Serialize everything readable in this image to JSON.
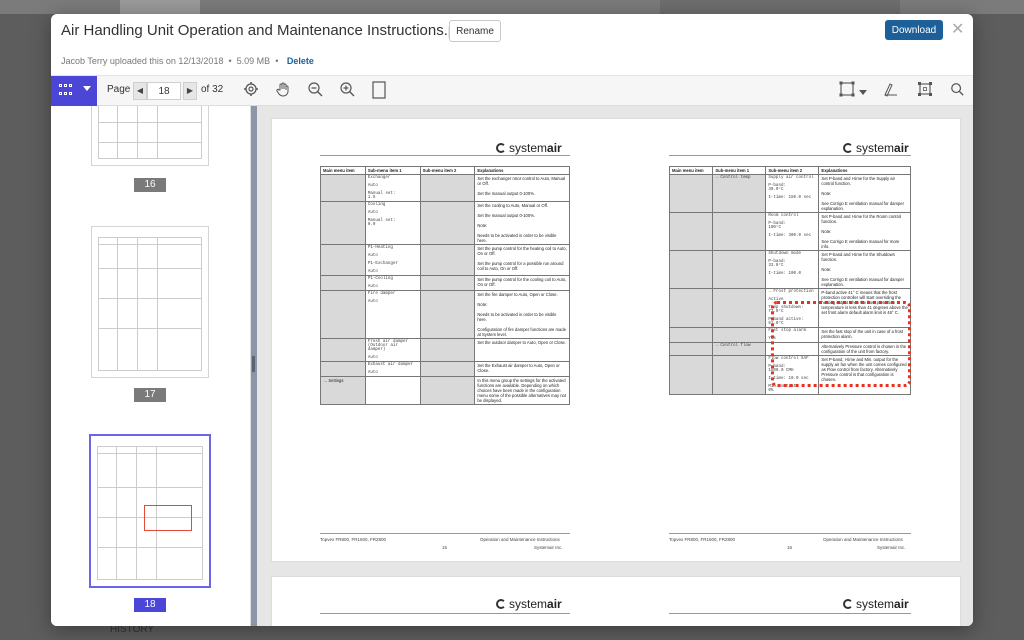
{
  "file": {
    "title": "Air Handling Unit Operation and Maintenance Instructions.pdf",
    "uploader_text": "Jacob Terry uploaded this on 12/13/2018",
    "size": "5.09 MB",
    "delete_label": "Delete",
    "rename_label": "Rename",
    "download_label": "Download",
    "close_glyph": "✕"
  },
  "toolbar": {
    "page_label": "Page",
    "current_page": "18",
    "of_label": "of 32",
    "prev_glyph": "◀",
    "next_glyph": "▶",
    "icons": [
      "gear-icon",
      "hand-icon",
      "zoom-out-icon",
      "zoom-in-icon",
      "fit-page-icon",
      "select-area-icon",
      "draw-icon",
      "crop-icon",
      "search-icon"
    ],
    "accent": "#4b46d6"
  },
  "thumbnails": [
    {
      "number": "16",
      "selected": false
    },
    {
      "number": "17",
      "selected": false
    },
    {
      "number": "18",
      "selected": true
    }
  ],
  "bg_peek": "HISTORY",
  "doc": {
    "logo_pre": "system",
    "logo_bold": "air",
    "headers": [
      "Main menu item",
      "Sub-menu item 1",
      "Sub-menu item 2",
      "Explanations"
    ],
    "left_rows": [
      {
        "c1": "",
        "c2": "Exchanger\n\nAuto\n\nManual set:\n1.5",
        "c3": "",
        "c4": "Set the exchanger rotor control to Auto, Manual or Off.\n\nSet the manual output 0-100%."
      },
      {
        "c1": "",
        "c2": "Cooling\n\nAuto\n\nManual set:\n0.0",
        "c3": "",
        "c4": "Set the cooling to Auto, Manual or Off.\n\nSet the manual output 0-100%.\n\nNote:\n\nNeeds to be activated in order to be visible here."
      },
      {
        "c1": "",
        "c2": "P1-Heating\n\nAuto\n\nP1-Exchanger\n\nAuto",
        "c3": "",
        "c4": "Set the pump control for the heating coil to Auto, On or Off.\n\nSet the pump control for a possible run around coil to Auto, On or Off."
      },
      {
        "c1": "",
        "c2": "P1-Cooling\n\nAuto",
        "c3": "",
        "c4": "Set the pump control for the cooling coil to Auto, On or Off."
      },
      {
        "c1": "",
        "c2": "Fire damper\n\nAuto",
        "c3": "",
        "c4": "Set the fire damper to Auto, Open or Close.\n\nNote:\n\nNeeds to be activated in order to be visible here.\n\nConfiguration of fire damper functions are made at System level."
      },
      {
        "c1": "",
        "c2": "Fresh air damper (Outdoor air damper)\n\nAuto",
        "c3": "",
        "c4": "Set the outdoor damper to Auto, Open or Close."
      },
      {
        "c1": "",
        "c2": "Exhaust air damper\n\nAuto",
        "c3": "",
        "c4": "Set the Exhaust air damper to Auto, Open or Close."
      },
      {
        "c1": "→ Settings",
        "c2": "",
        "c3": "",
        "c4": "In this menu group the settings for the activated functions are available. Depending on which choices have been made in the configuration menu some of the possible alternatives may not be displayed."
      }
    ],
    "right_rows": [
      {
        "c1": "",
        "c2": "→ Control temp",
        "c3": "Supply air control\n\nP-band:\n30.0°C\n\nI-time: 150.0 sec",
        "c4": "Set P-band and I-time for the Supply air control function.\n\nNote:\n\nSee Corrigo E ventilation manual for damper explanation."
      },
      {
        "c1": "",
        "c2": "",
        "c3": "Room control\n\nP-band:\n100°C\n\nI-time: 300.0 sec",
        "c4": "Set P-band and I-time for the Room control function.\n\nNote:\n\nSee Corrigo E ventilation manual for more info."
      },
      {
        "c1": "",
        "c2": "",
        "c3": "Shutdown mode\n\nP-band:\n33.0°C\n\nI-time: 100.0",
        "c4": "Set P-band and I-time for the Shutdown function.\n\nNote:\n\nSee Corrigo E ventilation manual for damper explanation."
      },
      {
        "c1": "",
        "c2": "",
        "c3": "→ Frost protection\n\nActive\n\nTemp shutdown: 77.0°C\n\nP-band active: 61.0°C",
        "c4": "P-band active 41° C means that the frost protection controller will start overriding the heating output when the frost protection temperature is less than 41 degrees above the set frost alarm default alarm limit is 46° C."
      },
      {
        "c1": "",
        "c2": "",
        "c3": "Fast stop alarm\n\nYes",
        "c4": "Set the fast stop of the unit in case of a frost protection alarm."
      },
      {
        "c1": "",
        "c2": "→ Control flow",
        "c3": "",
        "c4": "Alternatively Pressure control is chosen in the configuration of the unit from factory."
      },
      {
        "c1": "",
        "c2": "",
        "c3": "Flow control SAF\n\nP-band:\n1500.0 CMH\n\nI-time: 10.0 sec\n\nMin. output:\n0%",
        "c4": "Set P-band, I-time and Min. output for the supply air fan when the unit comes configured as Flow control from factory. Alternatively Pressure control is that configuration is chosen."
      }
    ],
    "footer_left_a": "Topvex FR800, FR1600, FR2800",
    "footer_right_a": "Operation and Maintenance Instructions",
    "footer_num_a": "15",
    "footer_sub_a": "Systemair Inc.",
    "footer_left_b": "Topvex FR800, FR1600, FR2800",
    "footer_right_b": "Operation and Maintenance Instructions",
    "footer_num_b": "16",
    "footer_sub_b": "Systemair Inc."
  }
}
